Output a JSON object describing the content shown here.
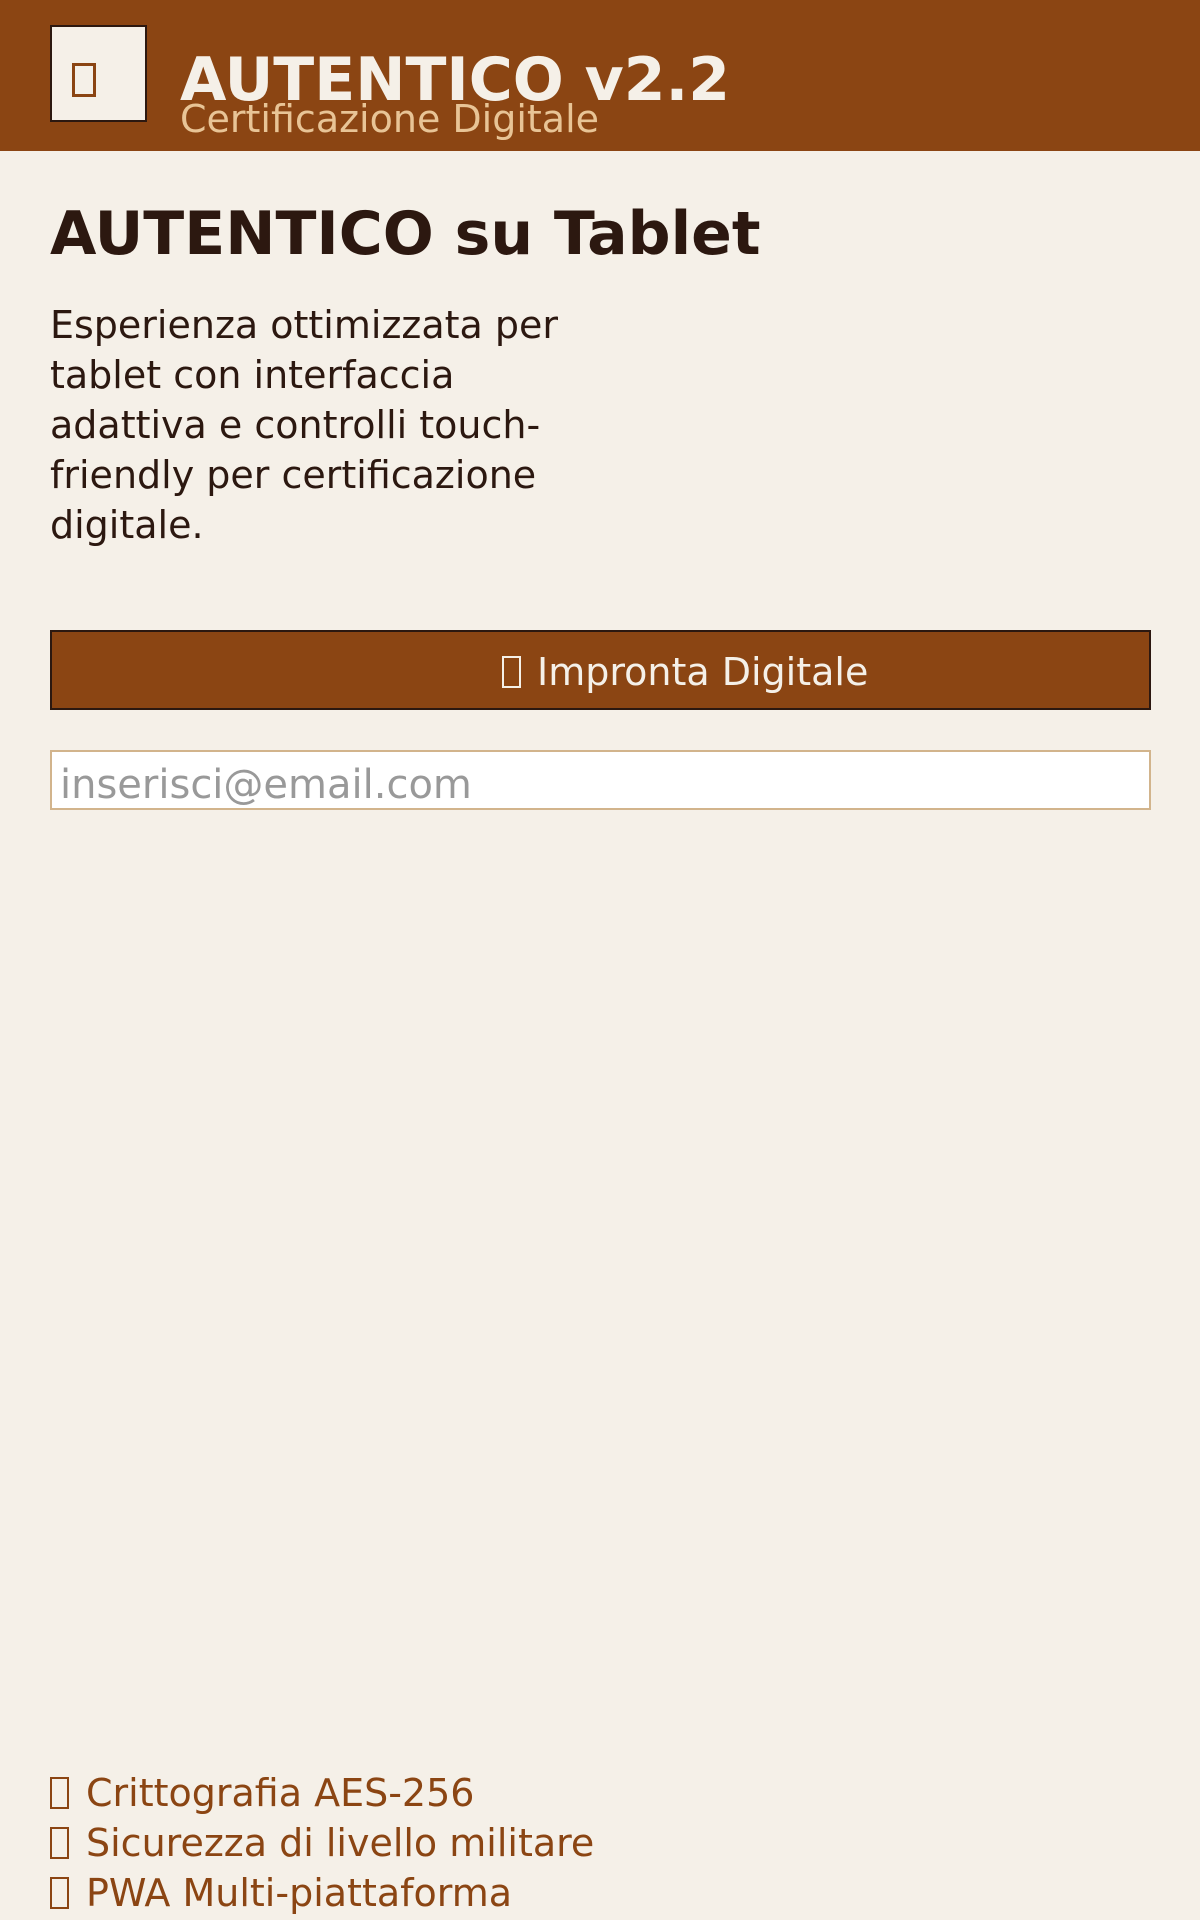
{
  "header": {
    "title": "AUTENTICO v2.2",
    "subtitle": "Certificazione Digitale",
    "logo_icon": "shield-icon"
  },
  "main": {
    "title": "AUTENTICO su Tablet",
    "description": "Esperienza ottimizzata per tablet con interfaccia adattiva e controlli touch-friendly per certificazione digitale.",
    "fingerprint_button": {
      "label": "Impronta Digitale",
      "icon": "fingerprint-icon"
    },
    "email": {
      "value": "",
      "placeholder": "inserisci@email.com"
    }
  },
  "features": [
    {
      "label": "Crittografia AES-256",
      "icon": "lock-icon"
    },
    {
      "label": "Sicurezza di livello militare",
      "icon": "shield-icon"
    },
    {
      "label": "PWA Multi-piattaforma",
      "icon": "devices-icon"
    }
  ],
  "colors": {
    "brand": "#8b4513",
    "background": "#f5f0e8",
    "text_dark": "#2c1810",
    "subtitle": "#e8c496",
    "input_border": "#d2b48c"
  }
}
